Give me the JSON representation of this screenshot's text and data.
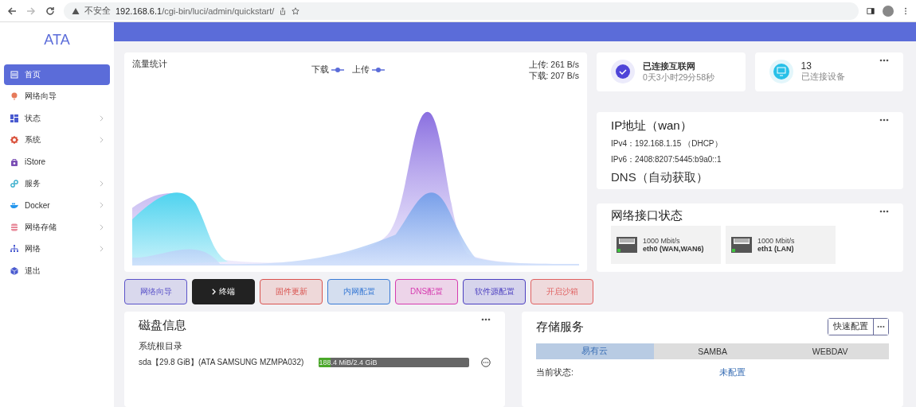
{
  "browser": {
    "security": "不安全",
    "url_host": "192.168.6.1",
    "url_path": "/cgi-bin/luci/admin/quickstart/"
  },
  "sidebar": {
    "logo": "ATA",
    "items": [
      {
        "label": "首页",
        "selected": true,
        "has_children": false
      },
      {
        "label": "网络向导",
        "selected": false,
        "has_children": false
      },
      {
        "label": "状态",
        "selected": false,
        "has_children": true
      },
      {
        "label": "系统",
        "selected": false,
        "has_children": true
      },
      {
        "label": "iStore",
        "selected": false,
        "has_children": false
      },
      {
        "label": "服务",
        "selected": false,
        "has_children": true
      },
      {
        "label": "Docker",
        "selected": false,
        "has_children": true
      },
      {
        "label": "网络存储",
        "selected": false,
        "has_children": true
      },
      {
        "label": "网络",
        "selected": false,
        "has_children": true
      },
      {
        "label": "退出",
        "selected": false,
        "has_children": false
      }
    ]
  },
  "traffic": {
    "title": "流量统计",
    "legend": [
      "下载",
      "上传"
    ],
    "upload": "上传: 261 B/s",
    "download": "下载: 207 B/s"
  },
  "internet": {
    "title": "已连接互联网",
    "uptime": "0天3小时29分58秒"
  },
  "devices": {
    "count": "13",
    "label": "已连接设备"
  },
  "ip": {
    "title": "IP地址（wan）",
    "ipv4_label": "IPv4：",
    "ipv4": "192.168.1.15 （DHCP）",
    "ipv6_label": "IPv6：",
    "ipv6": "2408:8207:5445:b9a0::1",
    "dns": "DNS（自动获取）"
  },
  "interfaces": {
    "title": "网络接口状态",
    "ports": [
      {
        "speed": "1000 Mbit/s",
        "name": "eth0 (WAN,WAN6)",
        "up": true
      },
      {
        "speed": "1000 Mbit/s",
        "name": "eth1 (LAN)",
        "up": true
      }
    ]
  },
  "actions": [
    {
      "label": "网络向导",
      "kind": "plain",
      "color": "#5b53c9"
    },
    {
      "label": "终端",
      "kind": "terminal",
      "color": "#222222"
    },
    {
      "label": "固件更新",
      "kind": "plain",
      "color": "#d9534f"
    },
    {
      "label": "内网配置",
      "kind": "plain",
      "color": "#3a7bd5"
    },
    {
      "label": "DNS配置",
      "kind": "plain",
      "color": "#d63bb0"
    },
    {
      "label": "软件源配置",
      "kind": "plain",
      "color": "#4b3fc0"
    },
    {
      "label": "开启沙箱",
      "kind": "plain",
      "color": "#e06060"
    }
  ],
  "disk": {
    "title": "磁盘信息",
    "section": "系统根目录",
    "device": "sda【29.8 GiB】(ATA SAMSUNG MZMPA032)",
    "usage": "188.4 MiB/2.4 GiB",
    "level": 0.077
  },
  "storage": {
    "title": "存储服务",
    "quick_button": "快速配置",
    "tabs": [
      {
        "label": "易有云",
        "selected": true
      },
      {
        "label": "SAMBA",
        "selected": false
      },
      {
        "label": "WEBDAV",
        "selected": false
      }
    ],
    "status_label": "当前状态:",
    "status_value": "未配置"
  }
}
